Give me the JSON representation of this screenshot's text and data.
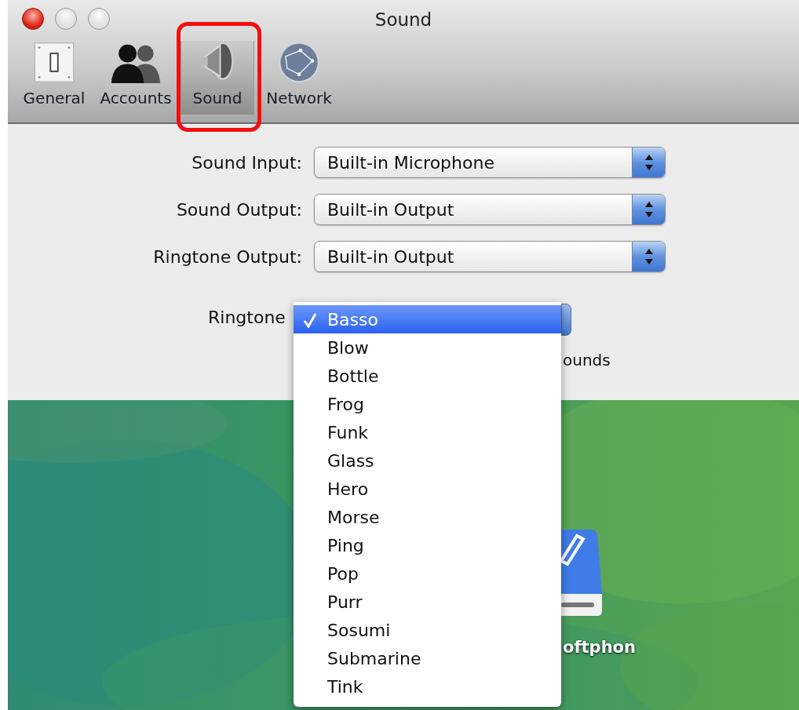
{
  "window": {
    "title": "Sound"
  },
  "toolbar": [
    {
      "label": "General",
      "kind": "general",
      "selected": false
    },
    {
      "label": "Accounts",
      "kind": "accounts",
      "selected": false
    },
    {
      "label": "Sound",
      "kind": "sound",
      "selected": true
    },
    {
      "label": "Network",
      "kind": "network",
      "selected": false
    }
  ],
  "fields": [
    {
      "label": "Sound Input:",
      "value": "Built-in Microphone"
    },
    {
      "label": "Sound Output:",
      "value": "Built-in Output"
    },
    {
      "label": "Ringtone Output:",
      "value": "Built-in Output"
    }
  ],
  "ringtone": {
    "label": "Ringtone",
    "note": "ounds"
  },
  "menu": {
    "items": [
      {
        "label": "Basso",
        "selected": true
      },
      {
        "label": "Blow",
        "selected": false
      },
      {
        "label": "Bottle",
        "selected": false
      },
      {
        "label": "Frog",
        "selected": false
      },
      {
        "label": "Funk",
        "selected": false
      },
      {
        "label": "Glass",
        "selected": false
      },
      {
        "label": "Hero",
        "selected": false
      },
      {
        "label": "Morse",
        "selected": false
      },
      {
        "label": "Ping",
        "selected": false
      },
      {
        "label": "Pop",
        "selected": false
      },
      {
        "label": "Purr",
        "selected": false
      },
      {
        "label": "Sosumi",
        "selected": false
      },
      {
        "label": "Submarine",
        "selected": false
      },
      {
        "label": "Tink",
        "selected": false
      }
    ]
  },
  "desktop": {
    "icon_label": "oftphon"
  }
}
